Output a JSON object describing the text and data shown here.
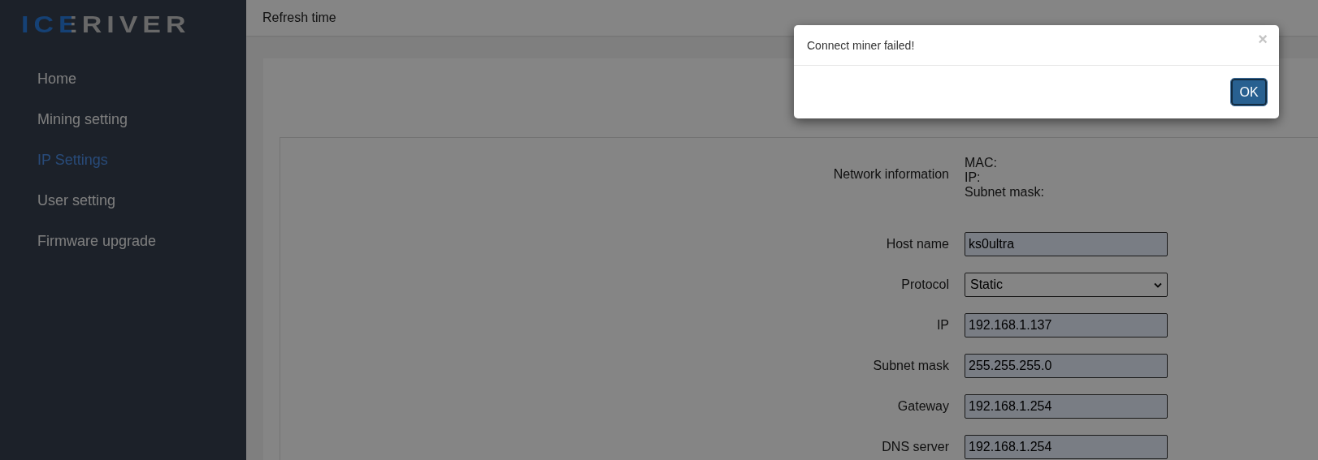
{
  "sidebar": {
    "logo": "ICERIVER",
    "items": [
      {
        "label": "Home",
        "selected": false
      },
      {
        "label": "Mining setting",
        "selected": false
      },
      {
        "label": "IP Settings",
        "selected": true
      },
      {
        "label": "User setting",
        "selected": false
      },
      {
        "label": "Firmware upgrade",
        "selected": false
      }
    ]
  },
  "header": {
    "text": "Refresh time"
  },
  "form": {
    "network_info": {
      "label": "Network information",
      "lines": [
        "MAC:",
        "IP:",
        "Subnet mask:"
      ]
    },
    "fields": [
      {
        "label": "Host name",
        "kind": "text",
        "value": "ks0ultra"
      },
      {
        "label": "Protocol",
        "kind": "select",
        "value": "Static"
      },
      {
        "label": "IP",
        "kind": "text",
        "value": "192.168.1.137"
      },
      {
        "label": "Subnet mask",
        "kind": "text",
        "value": "255.255.255.0"
      },
      {
        "label": "Gateway",
        "kind": "text",
        "value": "192.168.1.254"
      },
      {
        "label": "DNS server",
        "kind": "text",
        "value": "192.168.1.254"
      }
    ]
  },
  "dialog": {
    "message": "Connect miner failed!",
    "close": "×",
    "button": "OK"
  }
}
